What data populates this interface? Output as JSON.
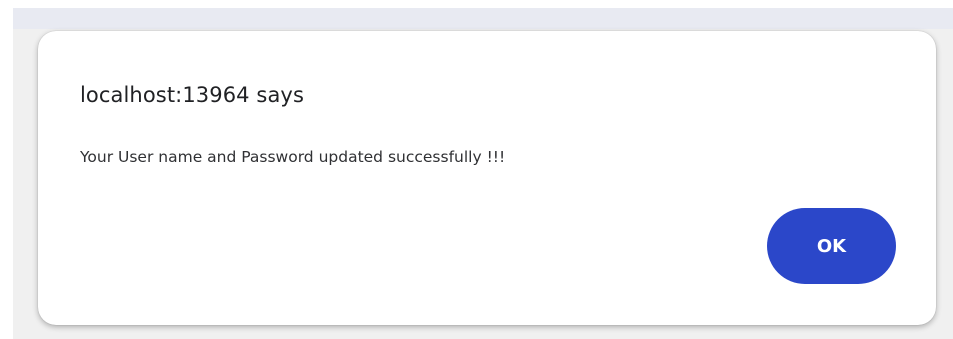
{
  "dialog": {
    "title": "localhost:13964 says",
    "message": "Your User name and Password updated successfully !!!",
    "ok_label": "OK"
  },
  "colors": {
    "ok_button_bg": "#2b47c9",
    "backdrop": "#f0f0f0",
    "top_bar": "#e8eaf2"
  }
}
